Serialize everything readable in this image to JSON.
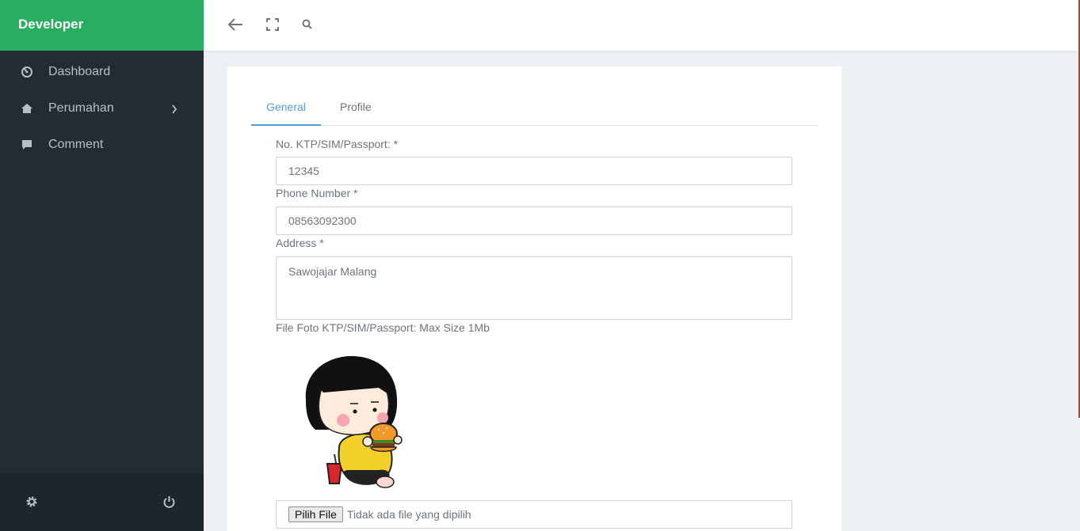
{
  "app": {
    "brand": "Developer"
  },
  "sidebar": {
    "items": [
      {
        "label": "Dashboard",
        "icon": "dashboard-icon"
      },
      {
        "label": "Perumahan",
        "icon": "home-icon",
        "has_submenu": true
      },
      {
        "label": "Comment",
        "icon": "comment-icon"
      }
    ],
    "footer": {
      "settings_icon": "gear-icon",
      "logout_icon": "power-icon"
    }
  },
  "topbar": {
    "icons": [
      "back-arrow-icon",
      "fullscreen-icon",
      "search-icon"
    ]
  },
  "tabs": [
    {
      "label": "General",
      "active": true
    },
    {
      "label": "Profile",
      "active": false
    }
  ],
  "form": {
    "ktp_label": "No. KTP/SIM/Passport: *",
    "ktp_value": "12345",
    "phone_label": "Phone Number *",
    "phone_value": "08563092300",
    "address_label": "Address *",
    "address_value": "Sawojajar Malang",
    "file_label": "File Foto KTP/SIM/Passport: Max Size 1Mb",
    "file_button": "Pilih File",
    "file_status": "Tidak ada file yang dipilih"
  },
  "colors": {
    "brand": "#27ae60",
    "sidebar": "#232c33",
    "accent": "#5b9bd5"
  }
}
